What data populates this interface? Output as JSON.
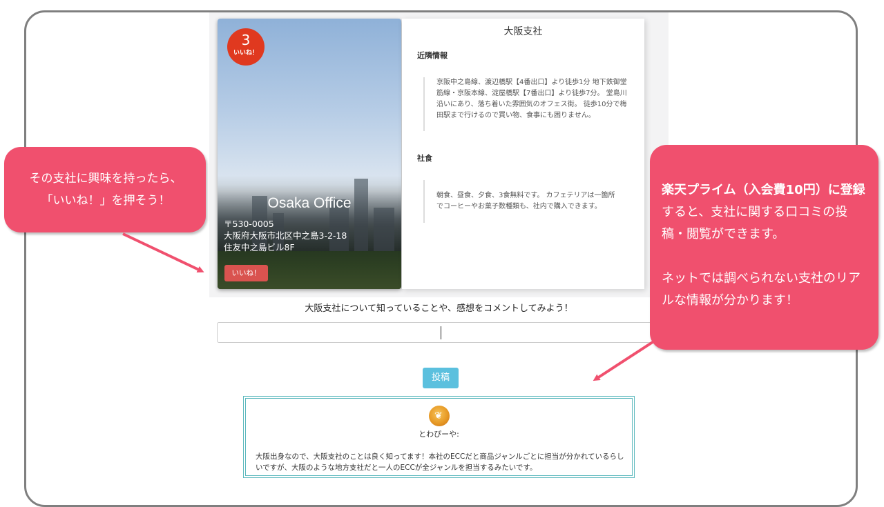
{
  "office": {
    "likes_count": "3",
    "likes_label": "いいね！",
    "name": "Osaka Office",
    "postal": "〒530-0005",
    "address": "大阪府大阪市北区中之島3-2-18",
    "building": "住友中之島ビル8F",
    "like_button": "いいね！"
  },
  "info": {
    "title": "大阪支社",
    "nearby_heading": "近隣情報",
    "nearby_text": "京阪中之島線、渡辺橋駅【4番出口】より徒歩1分 地下鉄御堂筋線・京阪本線、淀屋橋駅【7番出口】より徒歩7分。 堂島川沿いにあり、落ち着いた雰囲気のオフェス街。 徒歩10分で梅田駅まで行けるので買い物、食事にも困りません。",
    "cafeteria_heading": "社食",
    "cafeteria_text": "朝食、昼食、夕食、3食無料です。 カフェテリアは一箇所でコーヒーやお菓子数種類も、社内で購入できます。"
  },
  "comment_form": {
    "prompt": "大阪支社について知っていることや、感想をコメントしてみよう！",
    "input_value": "",
    "post_button": "投稿"
  },
  "comment": {
    "username": "とわぴーや:",
    "text": "大阪出身なので、大阪支社のことは良く知ってます！本社のECCだと商品ジャンルごとに担当が分かれているらしいですが、大阪のような地方支社だと一人のECCが全ジャンルを担当するみたいです。"
  },
  "callouts": {
    "left_line1": "その支社に興味を持ったら、",
    "left_line2": "「いいね！」を押そう！",
    "right_bold1": "楽天プライム（入会費10円）に",
    "right_bold2": "登録",
    "right_rest": "すると、支社に関する口コミの投稿・閲覧ができます。",
    "right_para2": "ネットでは調べられない支社のリアルな情報が分かります！"
  },
  "colors": {
    "callout": "#f0506e",
    "badge": "#e0391f",
    "like_button": "#d9534f",
    "post_button": "#5bc0de",
    "comment_border": "#5bb8bd"
  }
}
